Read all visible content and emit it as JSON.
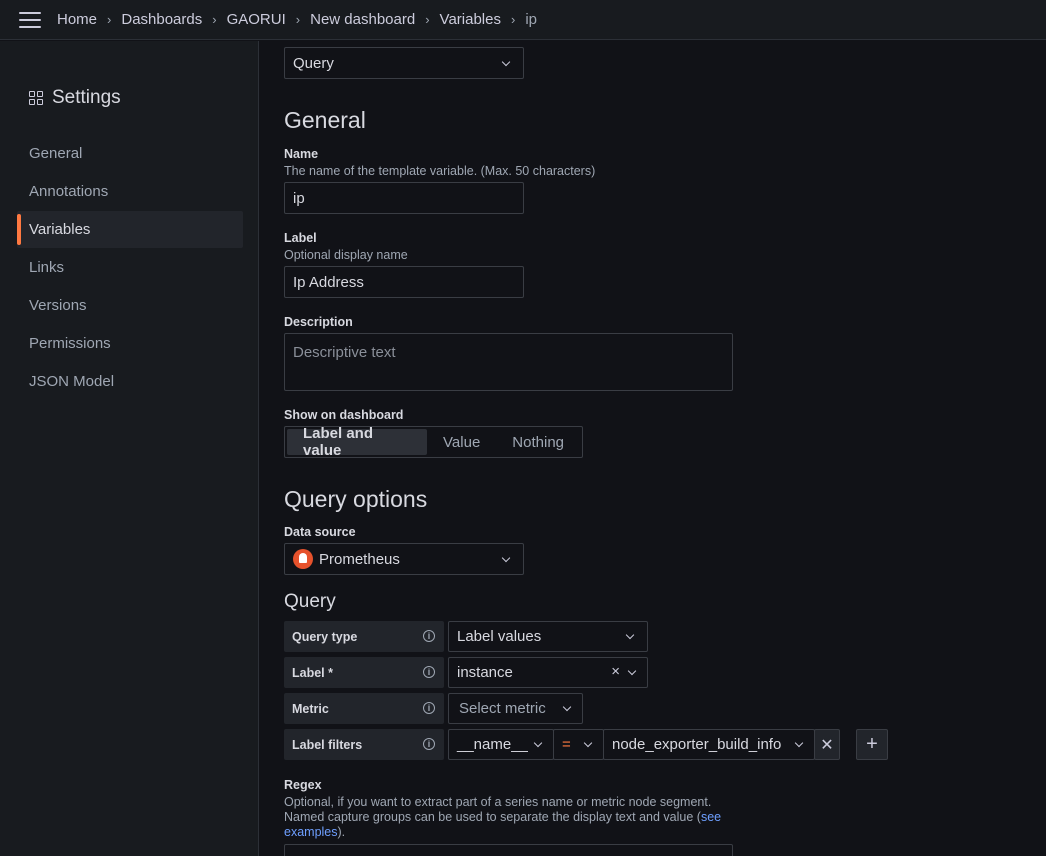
{
  "breadcrumbs": [
    "Home",
    "Dashboards",
    "GAORUI",
    "New dashboard",
    "Variables",
    "ip"
  ],
  "sidebar": {
    "title": "Settings",
    "items": [
      "General",
      "Annotations",
      "Variables",
      "Links",
      "Versions",
      "Permissions",
      "JSON Model"
    ],
    "active": "Variables"
  },
  "variable_type": {
    "value": "Query"
  },
  "general": {
    "heading": "General",
    "name": {
      "label": "Name",
      "description": "The name of the template variable. (Max. 50 characters)",
      "value": "ip"
    },
    "label": {
      "label": "Label",
      "description": "Optional display name",
      "value": "Ip Address"
    },
    "description": {
      "label": "Description",
      "placeholder": "Descriptive text"
    },
    "show_on_dashboard": {
      "label": "Show on dashboard",
      "options": [
        "Label and value",
        "Value",
        "Nothing"
      ],
      "selected": "Label and value"
    }
  },
  "query_options": {
    "heading": "Query options",
    "data_source": {
      "label": "Data source",
      "value": "Prometheus"
    }
  },
  "query": {
    "heading": "Query",
    "query_type": {
      "label": "Query type",
      "value": "Label values"
    },
    "label_field": {
      "label": "Label *",
      "value": "instance"
    },
    "metric": {
      "label": "Metric",
      "placeholder": "Select metric"
    },
    "label_filters": {
      "label": "Label filters",
      "key": "__name__",
      "operator": "=",
      "value": "node_exporter_build_info"
    }
  },
  "regex": {
    "label": "Regex",
    "description_line1": "Optional, if you want to extract part of a series name or metric node segment.",
    "description_line2": "Named capture groups can be used to separate the display text and value (",
    "link1": "see",
    "link2": "examples",
    "description_end": ")."
  },
  "colors": {
    "accent": "#ff7941",
    "link": "#6e9fff",
    "background": "#111217",
    "panel": "#181b1f"
  },
  "icons": {
    "menu": "hamburger-icon",
    "settings": "grid-icon",
    "info": "info-icon",
    "clear": "close-icon",
    "add": "plus-icon",
    "datasource": "prometheus-logo-icon"
  }
}
